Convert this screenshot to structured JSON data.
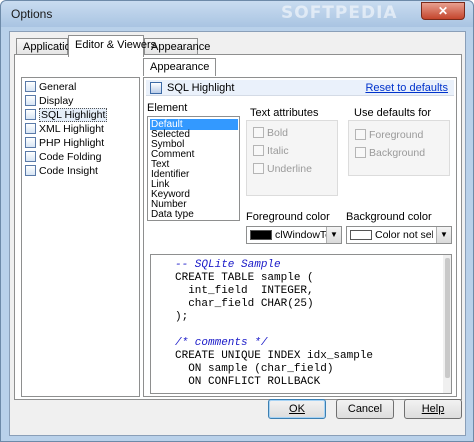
{
  "window": {
    "title": "Options",
    "watermark": "SOFTPEDIA",
    "close_label": "✕"
  },
  "tabs": [
    {
      "label": "Application",
      "active": false
    },
    {
      "label": "Editor & Viewers",
      "active": true
    },
    {
      "label": "Appearance",
      "active": false
    }
  ],
  "tree": {
    "items": [
      {
        "label": "General",
        "icon": "page-icon",
        "selected": false
      },
      {
        "label": "Display",
        "icon": "page-icon",
        "selected": false
      },
      {
        "label": "SQL Highlight",
        "icon": "highlight-icon",
        "selected": true
      },
      {
        "label": "XML Highlight",
        "icon": "highlight-icon",
        "selected": false
      },
      {
        "label": "PHP Highlight",
        "icon": "highlight-icon",
        "selected": false
      },
      {
        "label": "Code Folding",
        "icon": "folding-icon",
        "selected": false
      },
      {
        "label": "Code Insight",
        "icon": "insight-icon",
        "selected": false
      }
    ]
  },
  "panel": {
    "title": "SQL Highlight",
    "reset_link": "Reset to defaults",
    "element_label": "Element",
    "elements": [
      "Default",
      "Selected",
      "Symbol",
      "Comment",
      "Text",
      "Identifier",
      "Link",
      "Keyword",
      "Number",
      "Data type"
    ],
    "selected_element": "Default",
    "text_attributes": {
      "label": "Text attributes",
      "options": [
        "Bold",
        "Italic",
        "Underline"
      ]
    },
    "use_defaults": {
      "label": "Use defaults for",
      "options": [
        "Foreground",
        "Background"
      ]
    },
    "foreground": {
      "label": "Foreground color",
      "value": "clWindowText",
      "swatch": "#000000"
    },
    "background": {
      "label": "Background color",
      "value": "Color not selected",
      "swatch": "#ffffff"
    }
  },
  "editor": {
    "lines": [
      {
        "text": "-- SQLite Sample",
        "comment": true
      },
      {
        "text": "CREATE TABLE sample (",
        "comment": false
      },
      {
        "text": "  int_field  INTEGER,",
        "comment": false
      },
      {
        "text": "  char_field CHAR(25)",
        "comment": false
      },
      {
        "text": ");",
        "comment": false
      },
      {
        "text": "",
        "comment": false
      },
      {
        "text": "/* comments */",
        "comment": true
      },
      {
        "text": "CREATE UNIQUE INDEX idx_sample",
        "comment": false
      },
      {
        "text": "  ON sample (char_field)",
        "comment": false
      },
      {
        "text": "  ON CONFLICT ROLLBACK",
        "comment": false
      }
    ]
  },
  "buttons": {
    "ok": "OK",
    "cancel": "Cancel",
    "help": "Help"
  },
  "colors": {
    "selection": "#3399ff",
    "comment": "#1a1ac8",
    "link": "#0033cc"
  }
}
